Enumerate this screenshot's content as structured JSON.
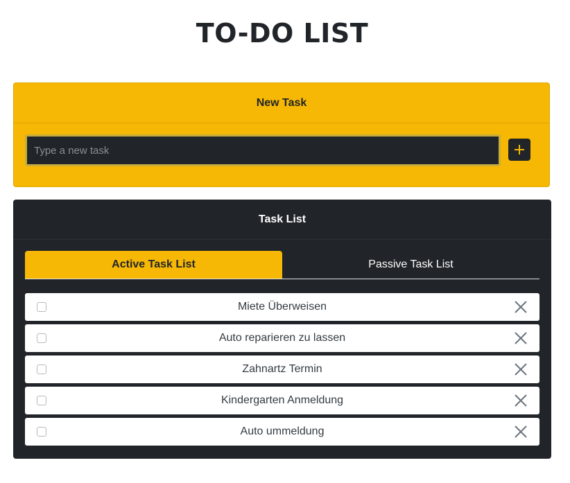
{
  "page": {
    "title": "TO-DO LIST"
  },
  "new_task": {
    "header": "New Task",
    "input_value": "",
    "input_placeholder": "Type a new task",
    "add_icon": "plus-icon"
  },
  "task_list": {
    "header": "Task List",
    "tabs": [
      {
        "label": "Active Task List",
        "active": true
      },
      {
        "label": "Passive Task List",
        "active": false
      }
    ],
    "items": [
      {
        "label": "Miete Überweisen",
        "checked": false
      },
      {
        "label": "Auto reparieren zu lassen",
        "checked": false
      },
      {
        "label": "Zahnartz Termin",
        "checked": false
      },
      {
        "label": "Kindergarten Anmeldung",
        "checked": false
      },
      {
        "label": "Auto ummeldung",
        "checked": false
      }
    ],
    "delete_icon": "close-icon"
  },
  "colors": {
    "accent": "#f6b804",
    "dark": "#212529",
    "white": "#ffffff"
  }
}
